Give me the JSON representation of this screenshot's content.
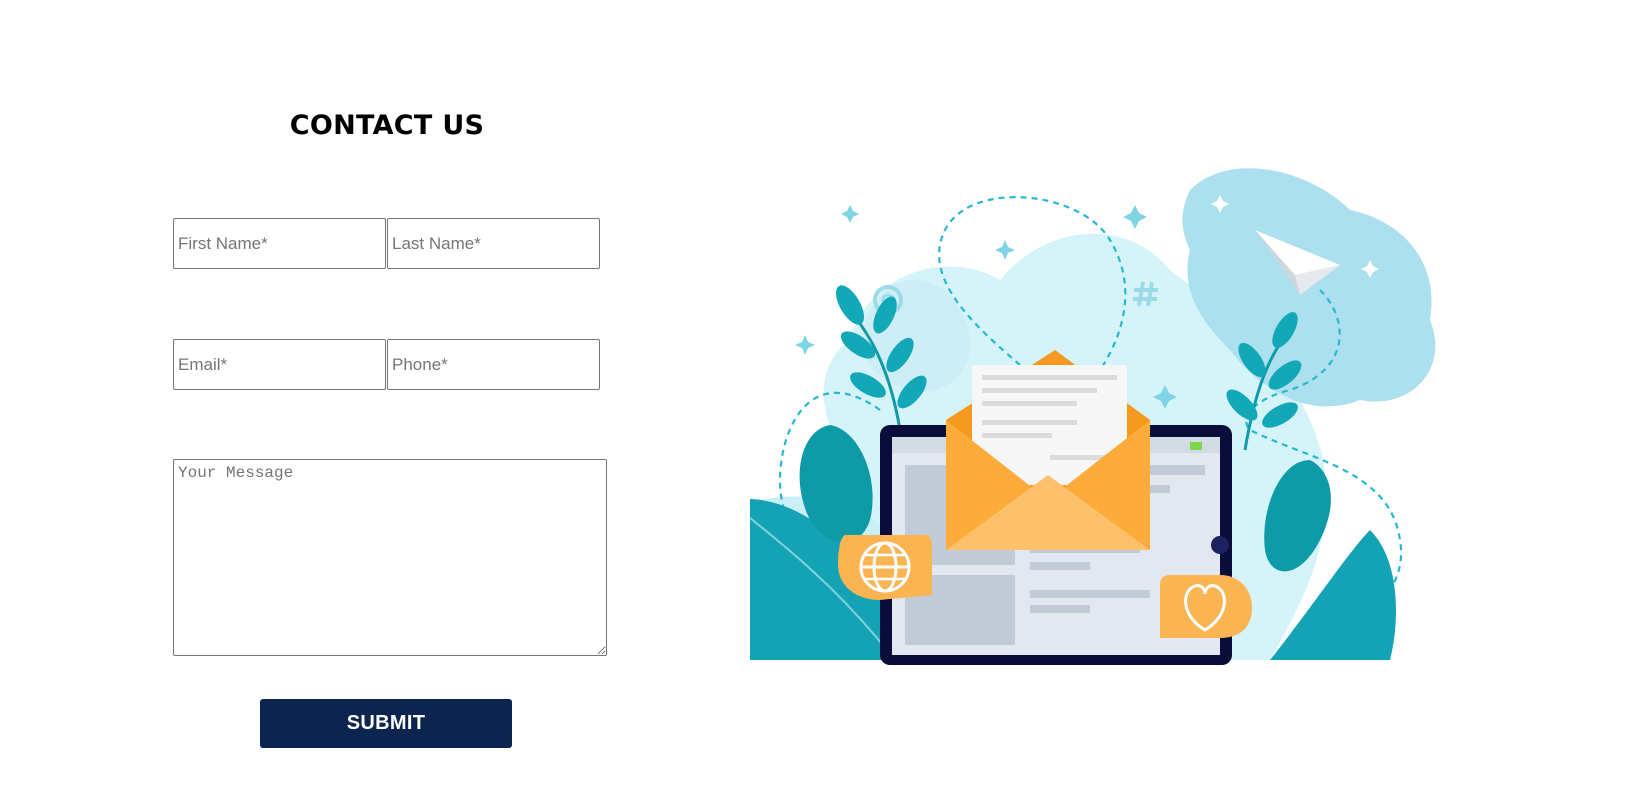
{
  "contact": {
    "title": "CONTACT US",
    "first_name_placeholder": "First Name*",
    "last_name_placeholder": "Last Name*",
    "email_placeholder": "Email*",
    "phone_placeholder": "Phone*",
    "message_placeholder": "Your Message",
    "submit_label": "SUBMIT"
  },
  "colors": {
    "submit_bg": "#0b2550",
    "accent_teal": "#14a3b4",
    "accent_orange": "#fda836",
    "tablet_frame": "#0a0d3a"
  },
  "illustration": {
    "icons": [
      "at-sign-icon",
      "hash-icon",
      "paper-plane-icon",
      "envelope-icon",
      "globe-icon",
      "heart-icon"
    ]
  }
}
